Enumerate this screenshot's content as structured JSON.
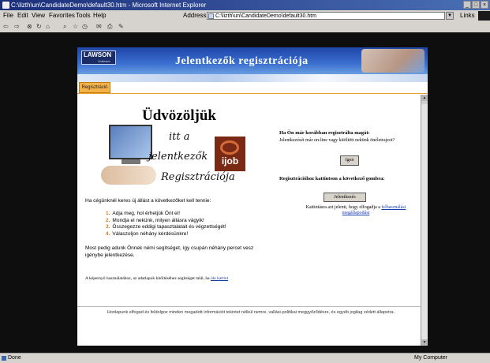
{
  "window": {
    "title": "C:\\lizth\\un\\CandidateDemo\\default30.htm - Microsoft Internet Explorer"
  },
  "menu": [
    "File",
    "Edit",
    "View",
    "Favorites",
    "Tools",
    "Help"
  ],
  "address": {
    "label": "Address",
    "value": "C:\\lizth\\un\\CandidateDemo\\default30.htm"
  },
  "links_label": "Links",
  "status": {
    "left": "Done",
    "right": "My Computer"
  },
  "page": {
    "logo": {
      "name": "LAWSON",
      "sub": "Software"
    },
    "banner_title": "Jelentkezők regisztrációja",
    "tab_label": "Regisztráció",
    "welcome": "Üdvözöljük",
    "script_lines": [
      "itt a",
      "jelentkezők",
      "Regisztrációja"
    ],
    "brand": "ijob",
    "registered": {
      "heading": "Ha Ön már korábban regisztrálta magát:",
      "text": "Jelentkezését már on-line vagy kitöltött nekünk önéletrajzot?",
      "button": "Igen"
    },
    "register": {
      "heading": "Regisztrációhoz kattintson a következő gombra:",
      "button": "Jelentkezés",
      "terms_prefix": "Kattintásra azt jelenti, hogy elfogadja a",
      "terms_link": "felhasználási megállapodást"
    },
    "intro": "Ha cégünknél keres új állást a következőket kell tennie:",
    "steps": [
      {
        "num": "1.",
        "text": "Adja meg, hol érhetjük Önt el!"
      },
      {
        "num": "2.",
        "text": "Mondja el nekünk, milyen állásra vágyik!"
      },
      {
        "num": "3.",
        "text": "Összegezze eddigi tapasztalatait és végzettségét!"
      },
      {
        "num": "4.",
        "text": "Válaszoljon néhány kérdésünkre!"
      }
    ],
    "help": "Most pedig adunk Önnek némi segítséget, így csupán néhány percet vesz igénybe jelentkezése.",
    "bottom_prefix": "A képernyő használatához, az adatlapok kitöltéséhez segítséget talál, ha",
    "bottom_link": "ide kattint",
    "footer": "Honlapunk elfogad és feldolgoz minden megadott információt tekintet nélkül nemre, vallási-politikai meggyőződésre, és egyéb jogilag védett állapotra."
  }
}
